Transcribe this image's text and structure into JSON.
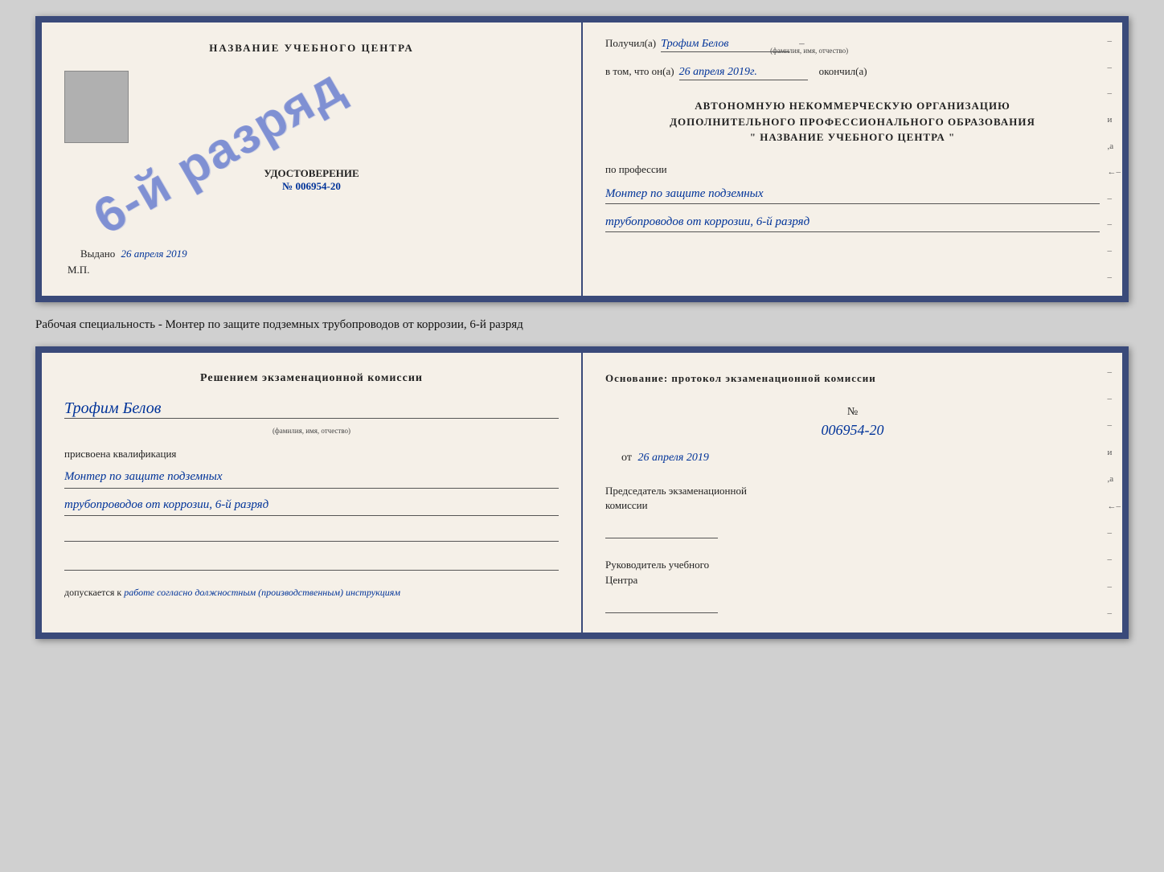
{
  "top": {
    "left": {
      "school_name": "НАЗВАНИЕ УЧЕБНОГО ЦЕНТРА",
      "cert_title": "УДОСТОВЕРЕНИЕ",
      "cert_number_prefix": "№",
      "cert_number": "006954-20",
      "issued_label": "Выдано",
      "issued_date": "26 апреля 2019",
      "mp_label": "М.П.",
      "stamp_text": "6-й разряд"
    },
    "right": {
      "received_label": "Получил(а)",
      "recipient_name": "Трофим Белов",
      "recipient_hint": "(фамилия, имя, отчество)",
      "date_prefix": "в том, что он(а)",
      "date_value": "26 апреля 2019г.",
      "date_suffix": "окончил(а)",
      "org_line1": "АВТОНОМНУЮ НЕКОММЕРЧЕСКУЮ ОРГАНИЗАЦИЮ",
      "org_line2": "ДОПОЛНИТЕЛЬНОГО ПРОФЕССИОНАЛЬНОГО ОБРАЗОВАНИЯ",
      "org_line3": "\"   НАЗВАНИЕ УЧЕБНОГО ЦЕНТРА   \"",
      "profession_label": "по профессии",
      "profession_line1": "Монтер по защите подземных",
      "profession_line2": "трубопроводов от коррозии, 6-й разряд"
    }
  },
  "work_specialty": "Рабочая специальность - Монтер по защите подземных трубопроводов от коррозии, 6-й разряд",
  "bottom": {
    "left": {
      "decision_title": "Решением экзаменационной комиссии",
      "person_name": "Трофим Белов",
      "person_hint": "(фамилия, имя, отчество)",
      "qualification_prefix": "присвоена квалификация",
      "qualification_line1": "Монтер по защите подземных",
      "qualification_line2": "трубопроводов от коррозии, 6-й разряд",
      "допускается_label": "допускается к",
      "допускается_value": "работе согласно должностным (производственным) инструкциям"
    },
    "right": {
      "basis_label": "Основание: протокол экзаменационной комиссии",
      "number_prefix": "№",
      "number": "006954-20",
      "date_prefix": "от",
      "date_value": "26 апреля 2019",
      "chairman_line1": "Председатель экзаменационной",
      "chairman_line2": "комиссии",
      "director_line1": "Руководитель учебного",
      "director_line2": "Центра"
    }
  },
  "side_marks": [
    "-",
    "-",
    "-",
    "и",
    ",а",
    "←",
    "-",
    "-",
    "-",
    "-",
    "-"
  ]
}
